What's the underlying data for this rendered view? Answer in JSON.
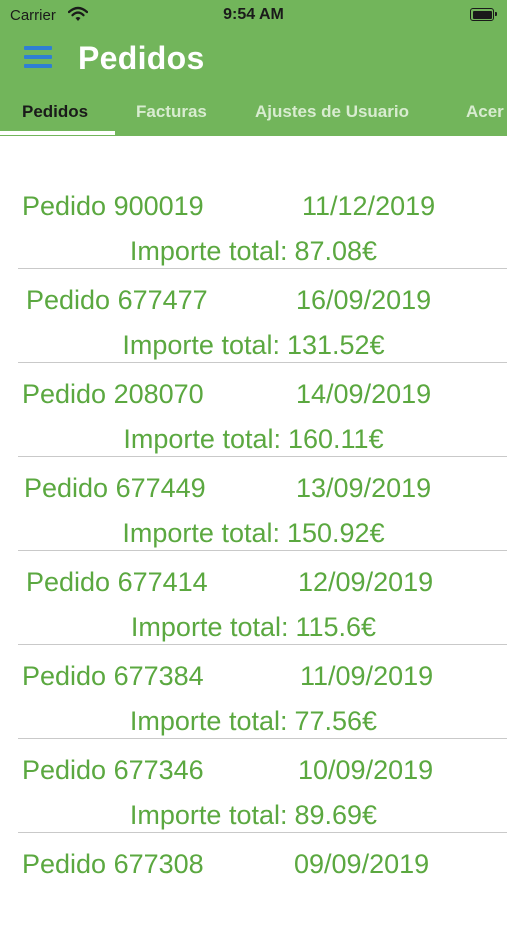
{
  "status_bar": {
    "carrier": "Carrier",
    "time": "9:54 AM"
  },
  "app_bar": {
    "title": "Pedidos"
  },
  "tabs": [
    {
      "label": "Pedidos",
      "active": true
    },
    {
      "label": "Facturas",
      "active": false
    },
    {
      "label": "Ajustes de Usuario",
      "active": false
    },
    {
      "label": "Acer",
      "active": false
    }
  ],
  "orders": {
    "total_label": "Importe total:",
    "items": [
      {
        "id": "Pedido 900019",
        "date": "11/12/2019",
        "total": "87.08€"
      },
      {
        "id": "Pedido 677477",
        "date": "16/09/2019",
        "total": "131.52€"
      },
      {
        "id": "Pedido 208070",
        "date": "14/09/2019",
        "total": "160.11€"
      },
      {
        "id": "Pedido 677449",
        "date": "13/09/2019",
        "total": "150.92€"
      },
      {
        "id": "Pedido 677414",
        "date": "12/09/2019",
        "total": "115.6€"
      },
      {
        "id": "Pedido 677384",
        "date": "11/09/2019",
        "total": "77.56€"
      },
      {
        "id": "Pedido 677346",
        "date": "10/09/2019",
        "total": "89.69€"
      },
      {
        "id": "Pedido 677308",
        "date": "09/09/2019",
        "total": ""
      }
    ]
  },
  "colors": {
    "header_green": "#72b55b",
    "text_green": "#5ba840",
    "menu_icon_blue": "#2f7fd4",
    "divider": "#c9c9c9"
  },
  "icons": [
    "wifi-icon",
    "battery-icon",
    "menu-icon"
  ]
}
